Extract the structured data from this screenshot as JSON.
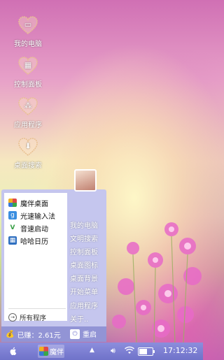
{
  "desktop": {
    "icons": [
      {
        "label": "我的电脑",
        "icon": "computer-icon"
      },
      {
        "label": "控制面板",
        "icon": "control-panel-icon"
      },
      {
        "label": "应用程序",
        "icon": "apps-icon"
      },
      {
        "label": "桌面搜索",
        "icon": "download-icon"
      }
    ]
  },
  "start_menu": {
    "apps": [
      {
        "label": "魔伴桌面",
        "icon": "moban-desktop-icon"
      },
      {
        "label": "光速输入法",
        "icon": "input-method-icon"
      },
      {
        "label": "音速启动",
        "icon": "launcher-icon"
      },
      {
        "label": "哈哈日历",
        "icon": "calendar-icon"
      }
    ],
    "all_programs": "所有程序",
    "right_items": [
      "我的电脑",
      "文明搜索",
      "控制面板",
      "桌面图标",
      "桌面背景",
      "开始菜单",
      "应用程序",
      "关于.."
    ],
    "earned": "已赚：2.61元",
    "reboot": "重启"
  },
  "taskbar": {
    "app_label": "魔伴",
    "time": "17:12:32",
    "battery_level": 0.7
  },
  "colors": {
    "menu_bg": "#c5c6ee",
    "taskbar": "#7b7ed2"
  }
}
